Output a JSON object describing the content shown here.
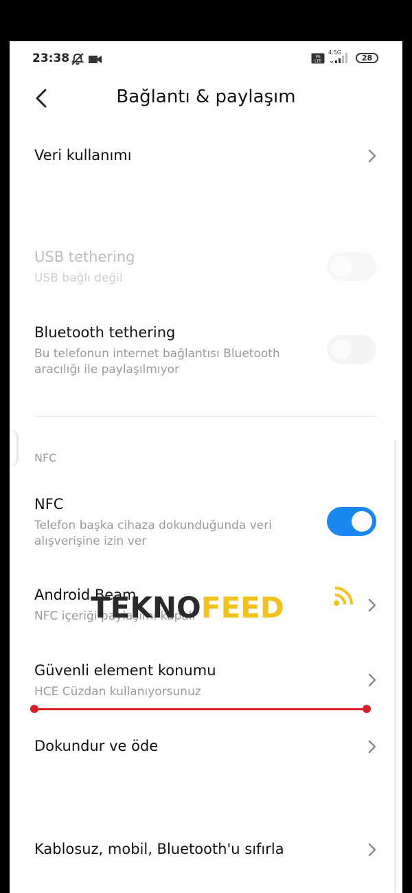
{
  "status_bar": {
    "time": "23:38",
    "network_label": "4.5G",
    "volte_label": "Vo LTE",
    "battery": "28"
  },
  "header": {
    "title": "Bağlantı & paylaşım"
  },
  "items": {
    "data_usage": {
      "title": "Veri kullanımı"
    },
    "usb_tethering": {
      "title": "USB tethering",
      "subtitle": "USB bağlı değil",
      "enabled": false,
      "toggle_on": false
    },
    "bluetooth_tethering": {
      "title": "Bluetooth tethering",
      "subtitle": "Bu telefonun internet bağlantısı Bluetooth\naracılığı ile paylaşılmıyor",
      "toggle_on": false
    },
    "nfc_section": {
      "label": "NFC"
    },
    "nfc": {
      "title": "NFC",
      "subtitle": "Telefon başka cihaza dokunduğunda veri\nalışverişine izin ver",
      "toggle_on": true
    },
    "android_beam": {
      "title": "Android Beam",
      "subtitle": "NFC içeriği paylaşımı kapalı"
    },
    "secure_element": {
      "title": "Güvenli element konumu",
      "subtitle": "HCE Cüzdan kullanıyorsunuz"
    },
    "tap_and_pay": {
      "title": "Dokundur ve öde"
    },
    "reset": {
      "title": "Kablosuz, mobil, Bluetooth'u sıfırla"
    }
  },
  "watermark": {
    "part1": "TEKNO",
    "part2": "FEED"
  },
  "colors": {
    "accent": "#1a86f0",
    "annotation": "#d61f26",
    "watermark_dark": "#2a2a2a",
    "watermark_yellow": "#f3c21a"
  }
}
